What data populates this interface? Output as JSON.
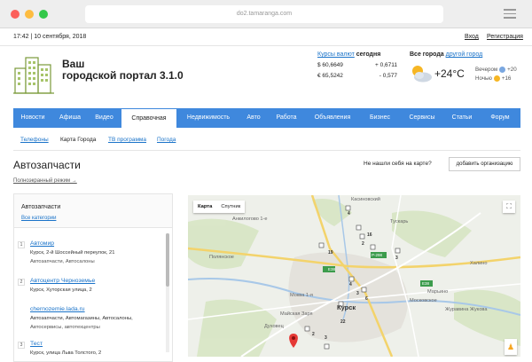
{
  "browser": {
    "url": "do2.tamaranga.com"
  },
  "topbar": {
    "date": "17:42 | 10 сентября, 2018",
    "login": "Вход",
    "register": "Регистрация"
  },
  "header": {
    "title_line1": "Ваш",
    "title_line2": "городской портал 3.1.0"
  },
  "currency": {
    "link": "Курсы валют",
    "today": "сегодня",
    "rows": [
      {
        "value": "$ 60,6649",
        "change": "+ 0,6711"
      },
      {
        "value": "€ 65,5242",
        "change": "- 0,577"
      }
    ]
  },
  "cities": {
    "all": "Все города",
    "other": "другой город",
    "temp": "+24°C",
    "evening_label": "Вечером",
    "evening_value": "+20",
    "night_label": "Ночью",
    "night_value": "+16"
  },
  "mainnav": [
    "Новости",
    "Афиша",
    "Видео",
    "Справочная",
    "Недвижимость",
    "Авто",
    "Работа",
    "Объявления",
    "Бизнес",
    "Сервисы",
    "Статьи",
    "Форум"
  ],
  "subnav": {
    "phones": "Телефоны",
    "city_map": "Карта Города",
    "tv": "ТВ программа",
    "weather": "Погода"
  },
  "page": {
    "title": "Автозапчасти",
    "fullscreen": "Полноэкранный режим →",
    "notfound": "Не нашли себя на карте?",
    "add_org": "добавить организацию"
  },
  "sidepanel": {
    "title": "Автозапчасти",
    "all_categories": "Все категории",
    "items": [
      {
        "num": "1",
        "name": "Автомир",
        "address": "Курск, 2-й Шоссейный переулок, 21",
        "category": "Автозапчасти, Автосалоны",
        "category2": ""
      },
      {
        "num": "2",
        "name": "Автоцентр Черноземье",
        "address": "Курск, Хуторская улица, 2",
        "category": "",
        "category2": ""
      },
      {
        "num": "",
        "name": "chernozemie.lada.ru",
        "address": "Автозапчасти, Автомагазины, Автосалоны,",
        "category": "Автосервисы, автотехцентры",
        "category2": ""
      },
      {
        "num": "3",
        "name": "Тест",
        "address": "Курск, улица Льва Толстого, 2",
        "category": "",
        "category2": ""
      }
    ]
  },
  "map": {
    "tab_map": "Карта",
    "tab_satellite": "Спутник",
    "labels": {
      "kasinovsky": "Касиновский",
      "tuskar": "Тускарь",
      "ankilogovo": "Анкилогово 1-е",
      "polyanskoe": "Полянское",
      "khalino": "Халино",
      "mokva": "Моква 1-я",
      "kursk": "Курск",
      "mayskaya": "Майская Заря",
      "dukhovets": "Духовец",
      "moskovskoe": "Московское",
      "maryino": "Марьино",
      "zhukova": "Журавина Жукова"
    },
    "roads": {
      "e38": "E38",
      "p298": "P-298"
    },
    "clusters": [
      "4",
      "2",
      "16",
      "19",
      "3",
      "4",
      "3",
      "6",
      "22",
      "3",
      "2"
    ]
  }
}
